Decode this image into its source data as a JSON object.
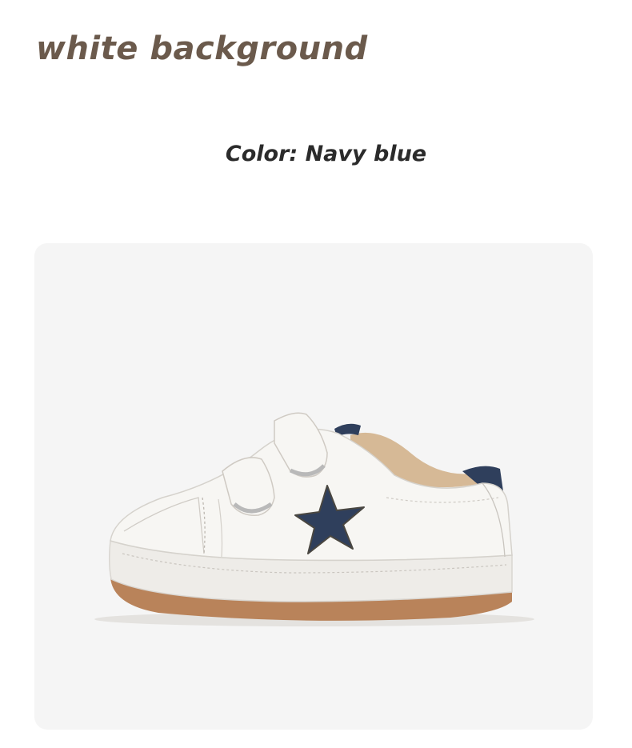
{
  "header": {
    "title": "white background"
  },
  "product": {
    "color_text": "Color: Navy blue",
    "image_icon": "navy-star-sneaker"
  },
  "colors": {
    "heading": "#6b5a4c",
    "label": "#2b2b2b",
    "card_background": "#f5f5f5",
    "navy_accent": "#2f3f5c",
    "sole": "#b9835a"
  }
}
